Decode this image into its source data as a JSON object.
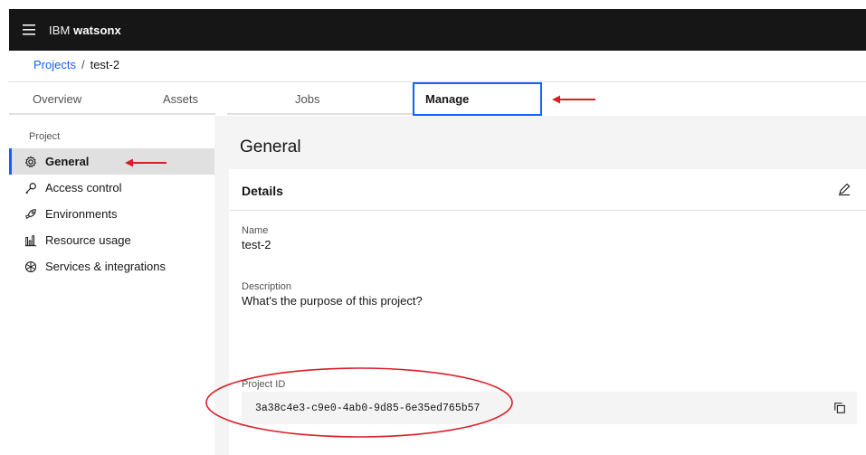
{
  "header": {
    "brand_prefix": "IBM",
    "brand_name": "watsonx"
  },
  "breadcrumb": {
    "parent": "Projects",
    "separator": "/",
    "current": "test-2"
  },
  "tabs": [
    {
      "label": "Overview",
      "active": false
    },
    {
      "label": "Assets",
      "active": false
    },
    {
      "label": "Jobs",
      "active": false
    },
    {
      "label": "Manage",
      "active": true
    }
  ],
  "sidebar": {
    "heading": "Project",
    "items": [
      {
        "label": "General",
        "icon": "gear-icon",
        "active": true
      },
      {
        "label": "Access control",
        "icon": "key-icon",
        "active": false
      },
      {
        "label": "Environments",
        "icon": "rocket-icon",
        "active": false
      },
      {
        "label": "Resource usage",
        "icon": "bar-chart-icon",
        "active": false
      },
      {
        "label": "Services & integrations",
        "icon": "network-icon",
        "active": false
      }
    ]
  },
  "main": {
    "title": "General",
    "details": {
      "title": "Details",
      "name_label": "Name",
      "name_value": "test-2",
      "description_label": "Description",
      "description_value": "What's the purpose of this project?",
      "project_id_label": "Project ID",
      "project_id_value": "3a38c4e3-c9e0-4ab0-9d85-6e35ed765b57"
    }
  },
  "colors": {
    "accent": "#0f62fe",
    "annotation": "#da1e28",
    "header_bg": "#161616"
  }
}
